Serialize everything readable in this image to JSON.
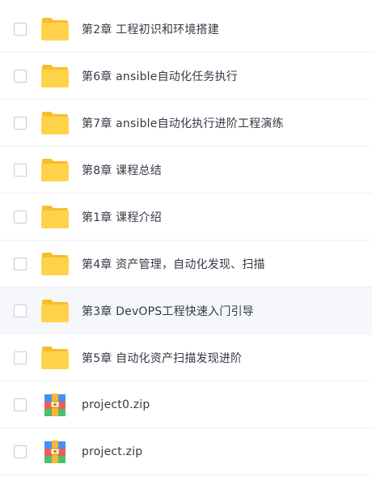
{
  "colors": {
    "folder_front": "#FFD24A",
    "folder_back": "#F7BE2A",
    "text": "#333A45",
    "row_hover": "#F5F7FB"
  },
  "files": [
    {
      "name": "第2章 工程初识和环境搭建",
      "type": "folder",
      "icon": "folder-icon"
    },
    {
      "name": "第6章 ansible自动化任务执行",
      "type": "folder",
      "icon": "folder-icon"
    },
    {
      "name": "第7章 ansible自动化执行进阶工程演练",
      "type": "folder",
      "icon": "folder-icon"
    },
    {
      "name": "第8章 课程总结",
      "type": "folder",
      "icon": "folder-icon"
    },
    {
      "name": "第1章 课程介绍",
      "type": "folder",
      "icon": "folder-icon"
    },
    {
      "name": "第4章 资产管理，自动化发现、扫描",
      "type": "folder",
      "icon": "folder-icon"
    },
    {
      "name": "第3章 DevOPS工程快速入门引导",
      "type": "folder",
      "icon": "folder-icon",
      "hovered": true
    },
    {
      "name": "第5章 自动化资产扫描发现进阶",
      "type": "folder",
      "icon": "folder-icon"
    },
    {
      "name": "project0.zip",
      "type": "zip",
      "icon": "zip-archive-icon"
    },
    {
      "name": "project.zip",
      "type": "zip",
      "icon": "zip-archive-icon"
    }
  ]
}
